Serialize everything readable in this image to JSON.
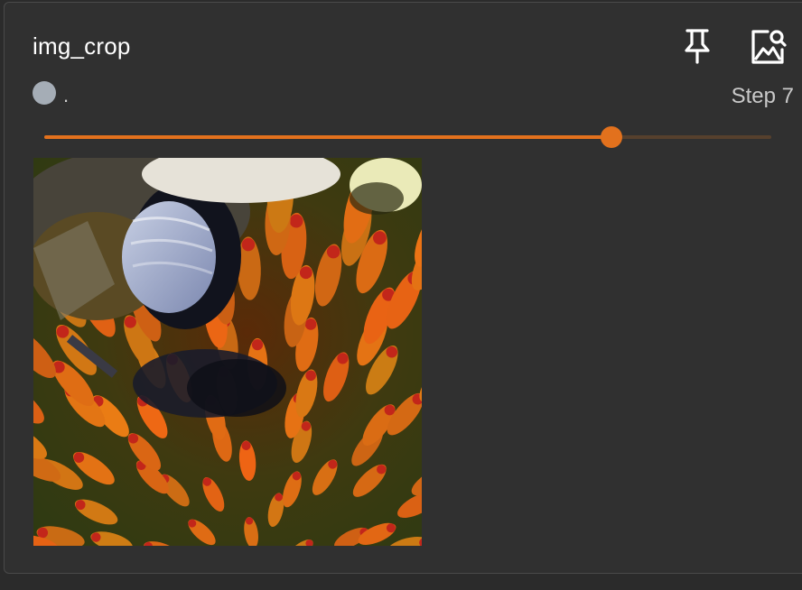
{
  "card": {
    "title": "img_crop",
    "run_label": ".",
    "step_label": "Step 7",
    "pin_icon": "pin-icon",
    "image_search_icon": "image-search-icon",
    "slider": {
      "value_fraction": 0.78,
      "accent_color": "#e2711d",
      "track_color": "#56402d"
    },
    "run_dot_color": "#a5adb6",
    "image": {
      "subject": "close-up of a bee on a coneflower head"
    }
  }
}
